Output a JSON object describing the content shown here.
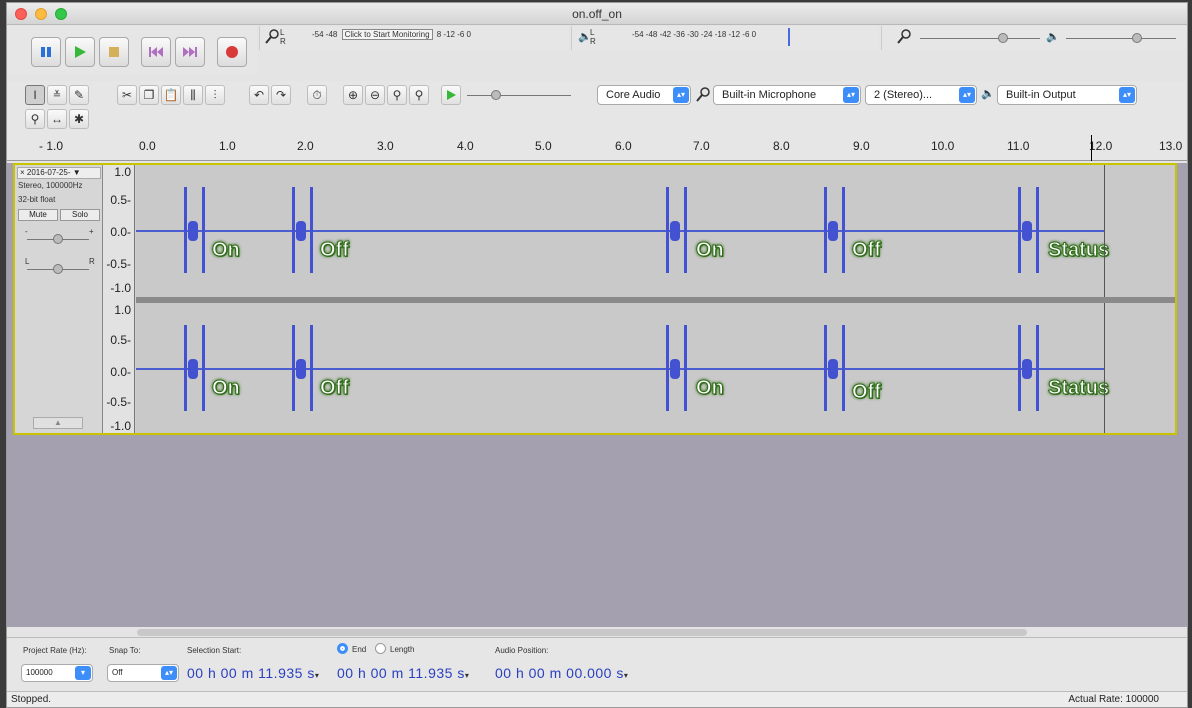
{
  "window": {
    "title": "on.off_on"
  },
  "meters": {
    "record_ticks": "-54  -48",
    "record_prompt": "Click to Start Monitoring",
    "record_ticks_end": "8  -12  -6  0",
    "play_ticks": "-54  -48  -42  -36  -30  -24  -18  -12  -6  0"
  },
  "device_toolbar": {
    "host": "Core Audio",
    "input_device": "Built-in Microphone",
    "channels": "2 (Stereo)...",
    "output_device": "Built-in Output"
  },
  "ruler": {
    "ticks": [
      "- 1.0",
      "0.0",
      "1.0",
      "2.0",
      "3.0",
      "4.0",
      "5.0",
      "6.0",
      "7.0",
      "8.0",
      "9.0",
      "10.0",
      "11.0",
      "12.0",
      "13.0"
    ]
  },
  "track": {
    "name": "2016-07-25-",
    "info_line1": "Stereo, 100000Hz",
    "info_line2": "32-bit float",
    "mute_label": "Mute",
    "solo_label": "Solo",
    "gain_left": "-",
    "gain_right": "+",
    "pan_left": "L",
    "pan_right": "R",
    "collapse_arrow": "▲",
    "y_labels": [
      "1.0",
      "0.5-",
      "0.0-",
      "-0.5-",
      "-1.0"
    ],
    "y_labels_2": [
      "1.0",
      "0.5-",
      "0.0-",
      "-0.5-",
      "-1.0"
    ],
    "annotations": [
      "On",
      "Off",
      "On",
      "Off",
      "Status"
    ]
  },
  "selection_toolbar": {
    "project_rate_label": "Project Rate (Hz):",
    "project_rate": "100000",
    "snap_label": "Snap To:",
    "snap_value": "Off",
    "sel_start_label": "Selection Start:",
    "end_label": "End",
    "length_label": "Length",
    "audio_pos_label": "Audio Position:",
    "sel_start": "00 h 00 m 11.935 s",
    "sel_end": "00 h 00 m 11.935 s",
    "audio_pos": "00 h 00 m 00.000 s"
  },
  "status": {
    "left": "Stopped.",
    "right": "Actual Rate: 100000"
  }
}
